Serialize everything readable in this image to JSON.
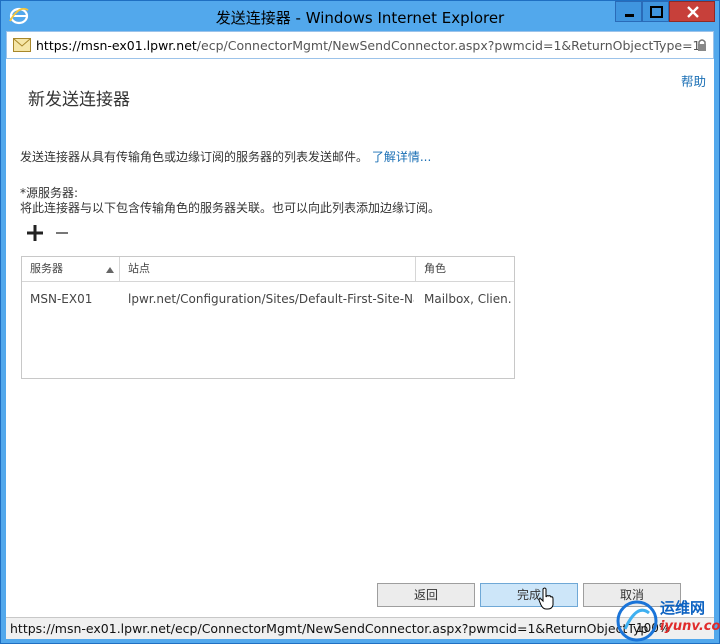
{
  "window": {
    "title": "发送连接器 - Windows Internet Explorer",
    "url_host": "https://msn-ex01.lpwr.net",
    "url_path": "/ecp/ConnectorMgmt/NewSendConnector.aspx?pwmcid=1&ReturnObjectType=1"
  },
  "page": {
    "help_link": "帮助",
    "title": "新发送连接器",
    "description": "发送连接器从具有传输角色或边缘订阅的服务器的列表发送邮件。",
    "learn_more": "了解详情...",
    "source_label": "*源服务器:",
    "source_hint": "将此连接器与以下包含传输角色的服务器关联。也可以向此列表添加边缘订阅。"
  },
  "grid": {
    "headers": [
      "服务器",
      "站点",
      "角色"
    ],
    "rows": [
      [
        "MSN-EX01",
        "lpwr.net/Configuration/Sites/Default-First-Site-Na...",
        "Mailbox, Clien..."
      ]
    ]
  },
  "buttons": {
    "back": "返回",
    "finish": "完成",
    "cancel": "取消"
  },
  "status": {
    "url": "https://msn-ex01.lpwr.net/ecp/ConnectorMgmt/NewSendConnector.aspx?pwmcid=1&ReturnObjectTyp",
    "zoom": "100%"
  },
  "watermark": {
    "name": "运维网",
    "site": "iyunv.com"
  },
  "colors": {
    "titlebar": "#52a8ec",
    "link": "#1a6fb5",
    "close": "#c7403a"
  }
}
